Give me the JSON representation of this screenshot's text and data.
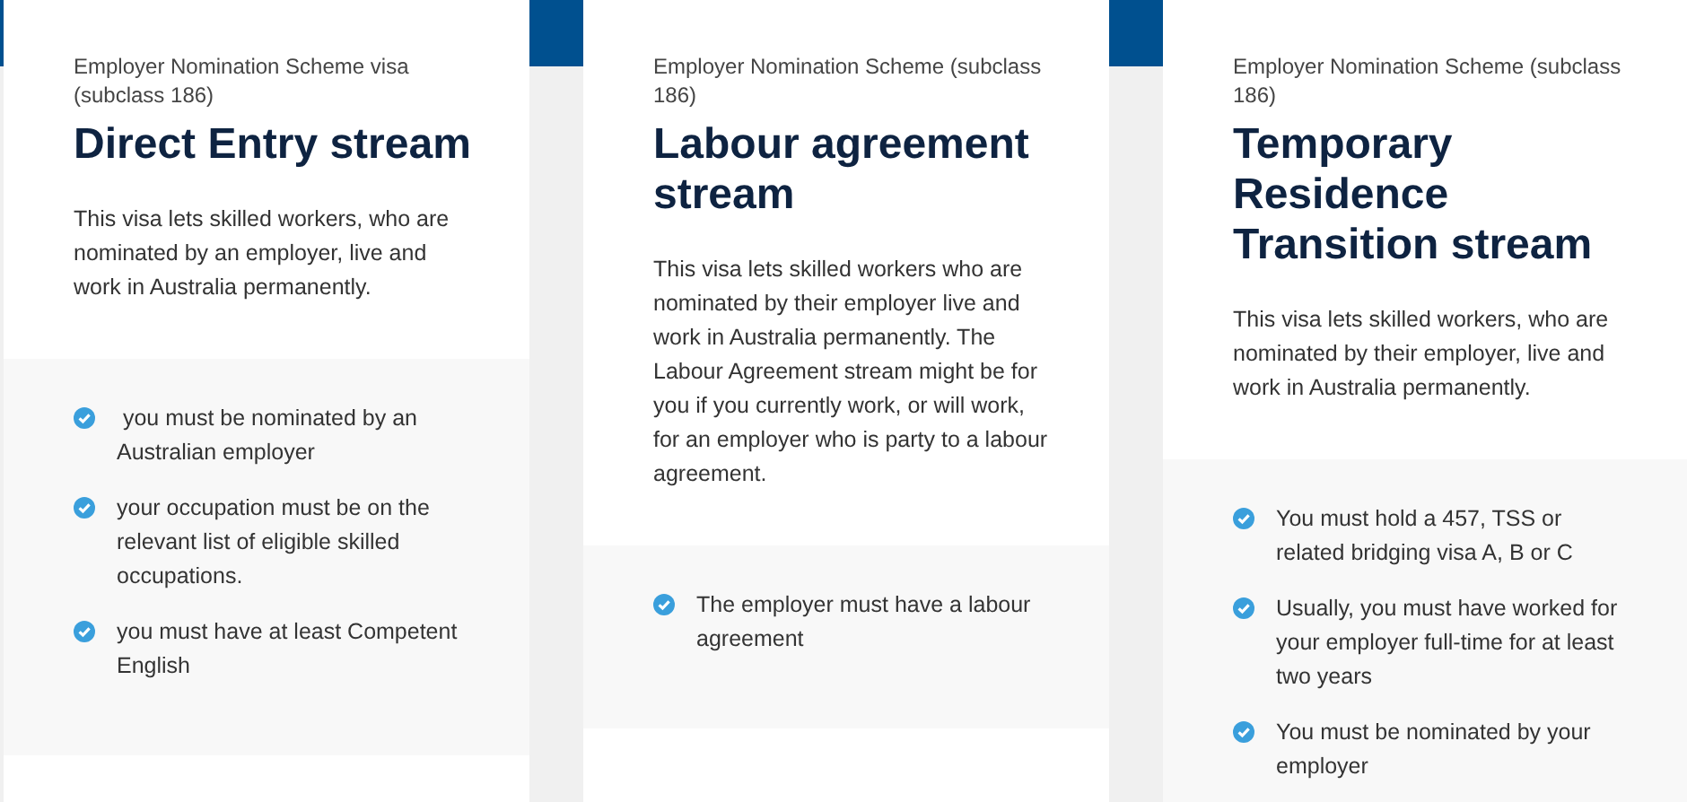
{
  "cards": [
    {
      "subtitle": "Employer Nomination Scheme visa (subclass 186)",
      "title": "Direct Entry stream",
      "description": "This visa lets skilled workers, who are nominated by an employer, live and work in Australia permanently.",
      "requirements": [
        " you must be nominated by an Australian employer",
        "your occupation must be on the relevant list of eligible skilled occupations.",
        "you must have at least Competent English"
      ]
    },
    {
      "subtitle": "Employer Nomination Scheme (subclass 186)",
      "title": "Labour agreement stream",
      "description": "This visa lets skilled workers who are nominated by their employer live and work in Australia permanently. The Labour Agreement stream might be for you if you currently work, or will work, for an employer who is party to a labour agreement.",
      "requirements": [
        "The employer must have a labour agreement"
      ]
    },
    {
      "subtitle": "Employer Nomination Scheme (subclass 186)",
      "title": "Temporary Residence Transition stream",
      "description": "This visa lets skilled workers, who are nominated by their employer, live and work in Australia permanently.",
      "requirements": [
        "You must hold a 457, TSS or related bridging visa A, B or C",
        "Usually, you must have worked for your employer full-time for at least two years",
        "You must be nominated by your employer"
      ]
    }
  ]
}
